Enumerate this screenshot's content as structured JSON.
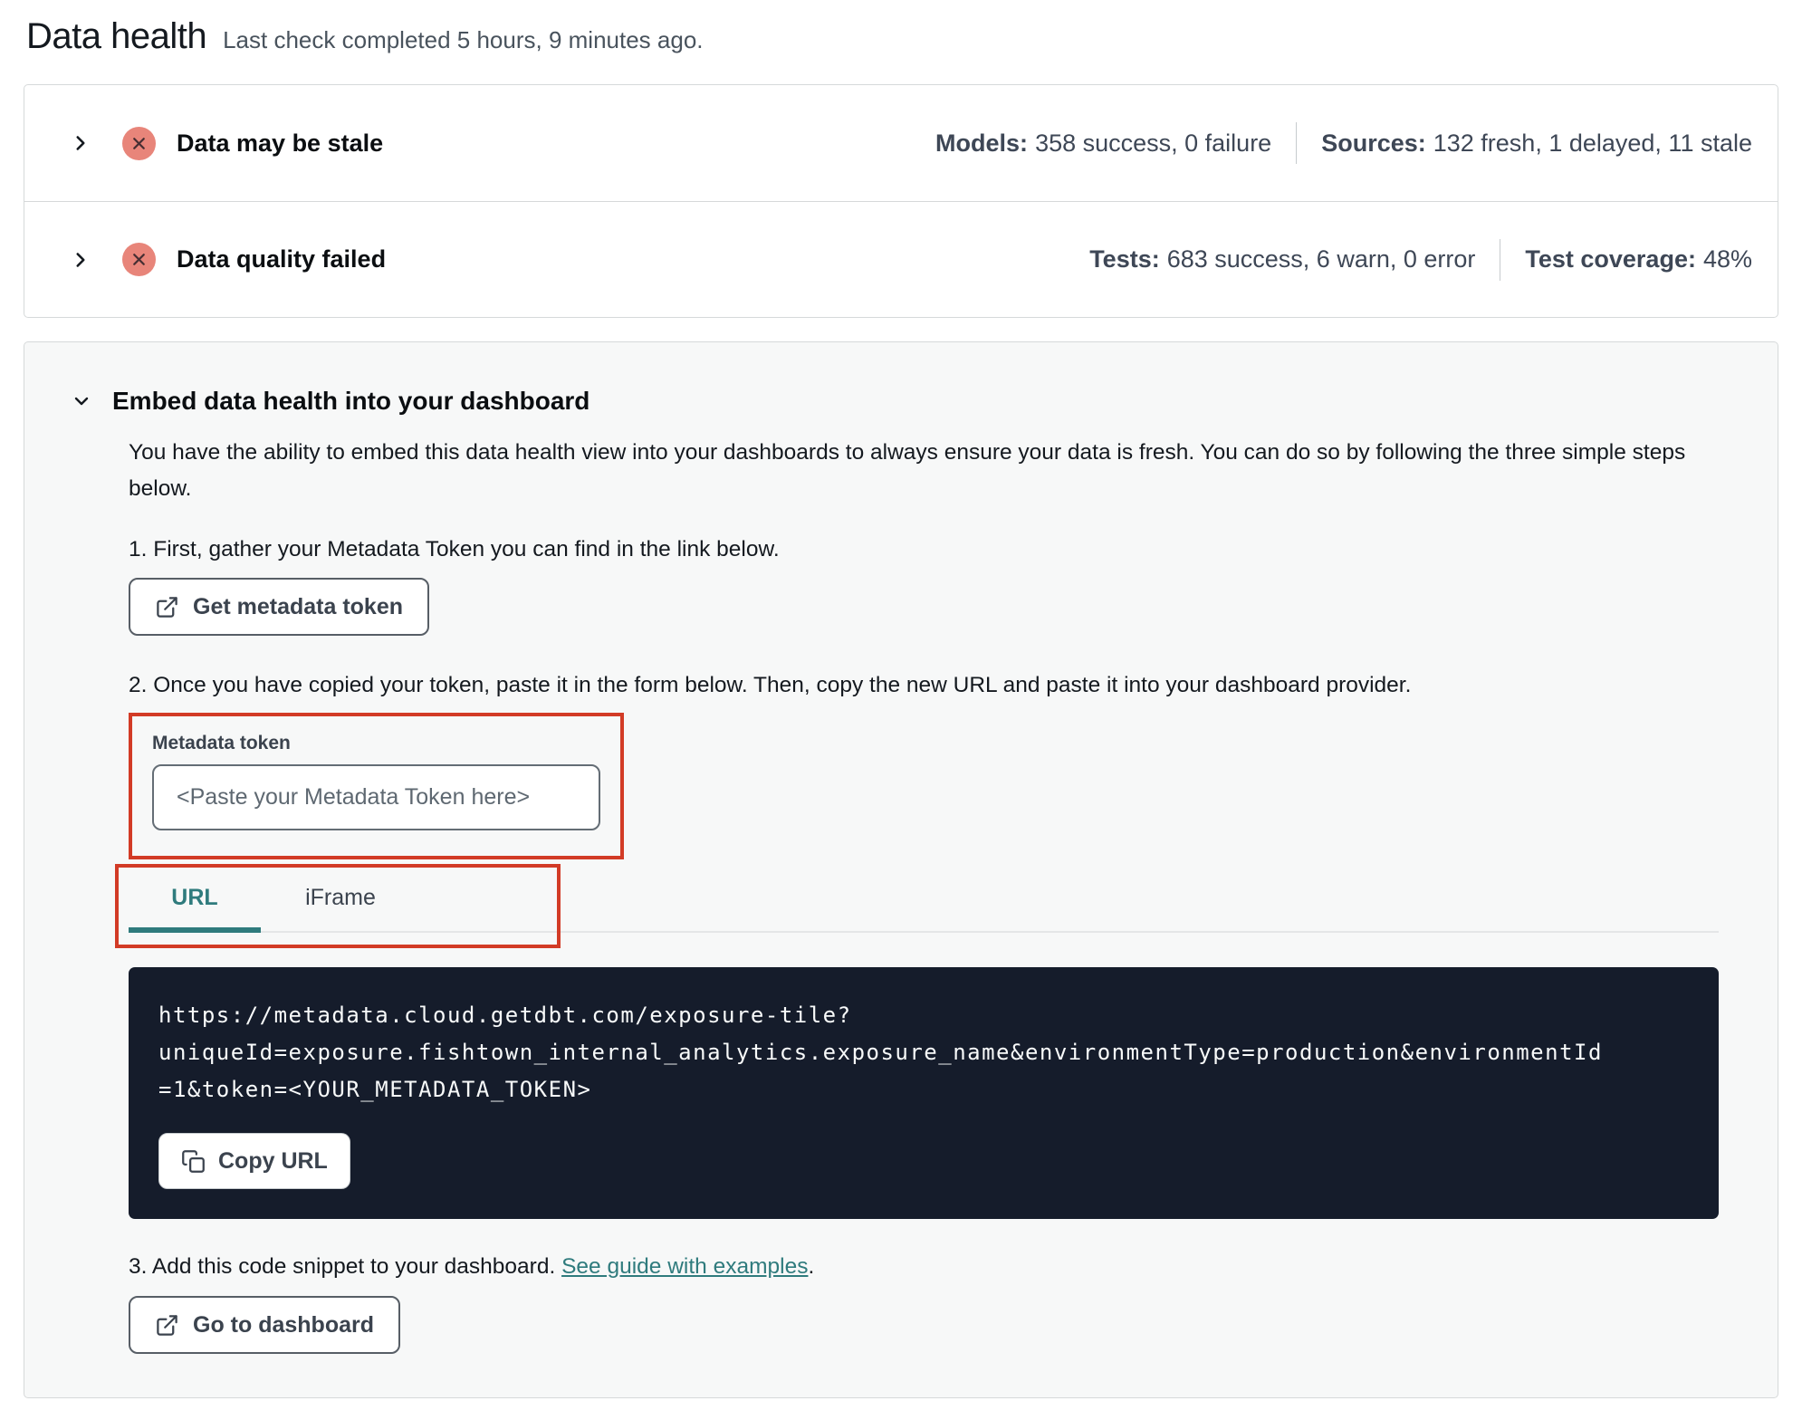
{
  "page": {
    "title": "Data health",
    "last_check": "Last check completed 5 hours, 9 minutes ago."
  },
  "status_rows": [
    {
      "label": "Data may be stale",
      "status": "error",
      "stats": [
        {
          "label": "Models:",
          "value": "358 success, 0 failure"
        },
        {
          "label": "Sources:",
          "value": "132 fresh, 1 delayed, 11 stale"
        }
      ]
    },
    {
      "label": "Data quality failed",
      "status": "error",
      "stats": [
        {
          "label": "Tests:",
          "value": "683 success, 6 warn, 0 error"
        },
        {
          "label": "Test coverage:",
          "value": "48%"
        }
      ]
    }
  ],
  "embed": {
    "heading": "Embed data health into your dashboard",
    "description": "You have the ability to embed this data health view into your dashboards to always ensure your data is fresh. You can do so by following the three simple steps below.",
    "step1": "1. First, gather your Metadata Token you can find in the link below.",
    "get_token_button": "Get metadata token",
    "step2": "2. Once you have copied your token, paste it in the form below. Then, copy the new URL and paste it into your dashboard provider.",
    "token_field": {
      "label": "Metadata token",
      "placeholder": "<Paste your Metadata Token here>",
      "value": ""
    },
    "tabs": [
      {
        "label": "URL",
        "active": true
      },
      {
        "label": "iFrame",
        "active": false
      }
    ],
    "code_url": "https://metadata.cloud.getdbt.com/exposure-tile?\nuniqueId=exposure.fishtown_internal_analytics.exposure_name&environmentType=production&environmentId\n=1&token=<YOUR_METADATA_TOKEN>",
    "copy_button": "Copy URL",
    "step3_prefix": "3. Add this code snippet to your dashboard. ",
    "step3_link": "See guide with examples",
    "step3_suffix": ".",
    "go_dashboard_button": "Go to dashboard"
  },
  "colors": {
    "annotation_red": "#d23b26",
    "status_error_bg": "#e8857a",
    "teal": "#2f7b7d",
    "code_bg": "#151c2b"
  }
}
